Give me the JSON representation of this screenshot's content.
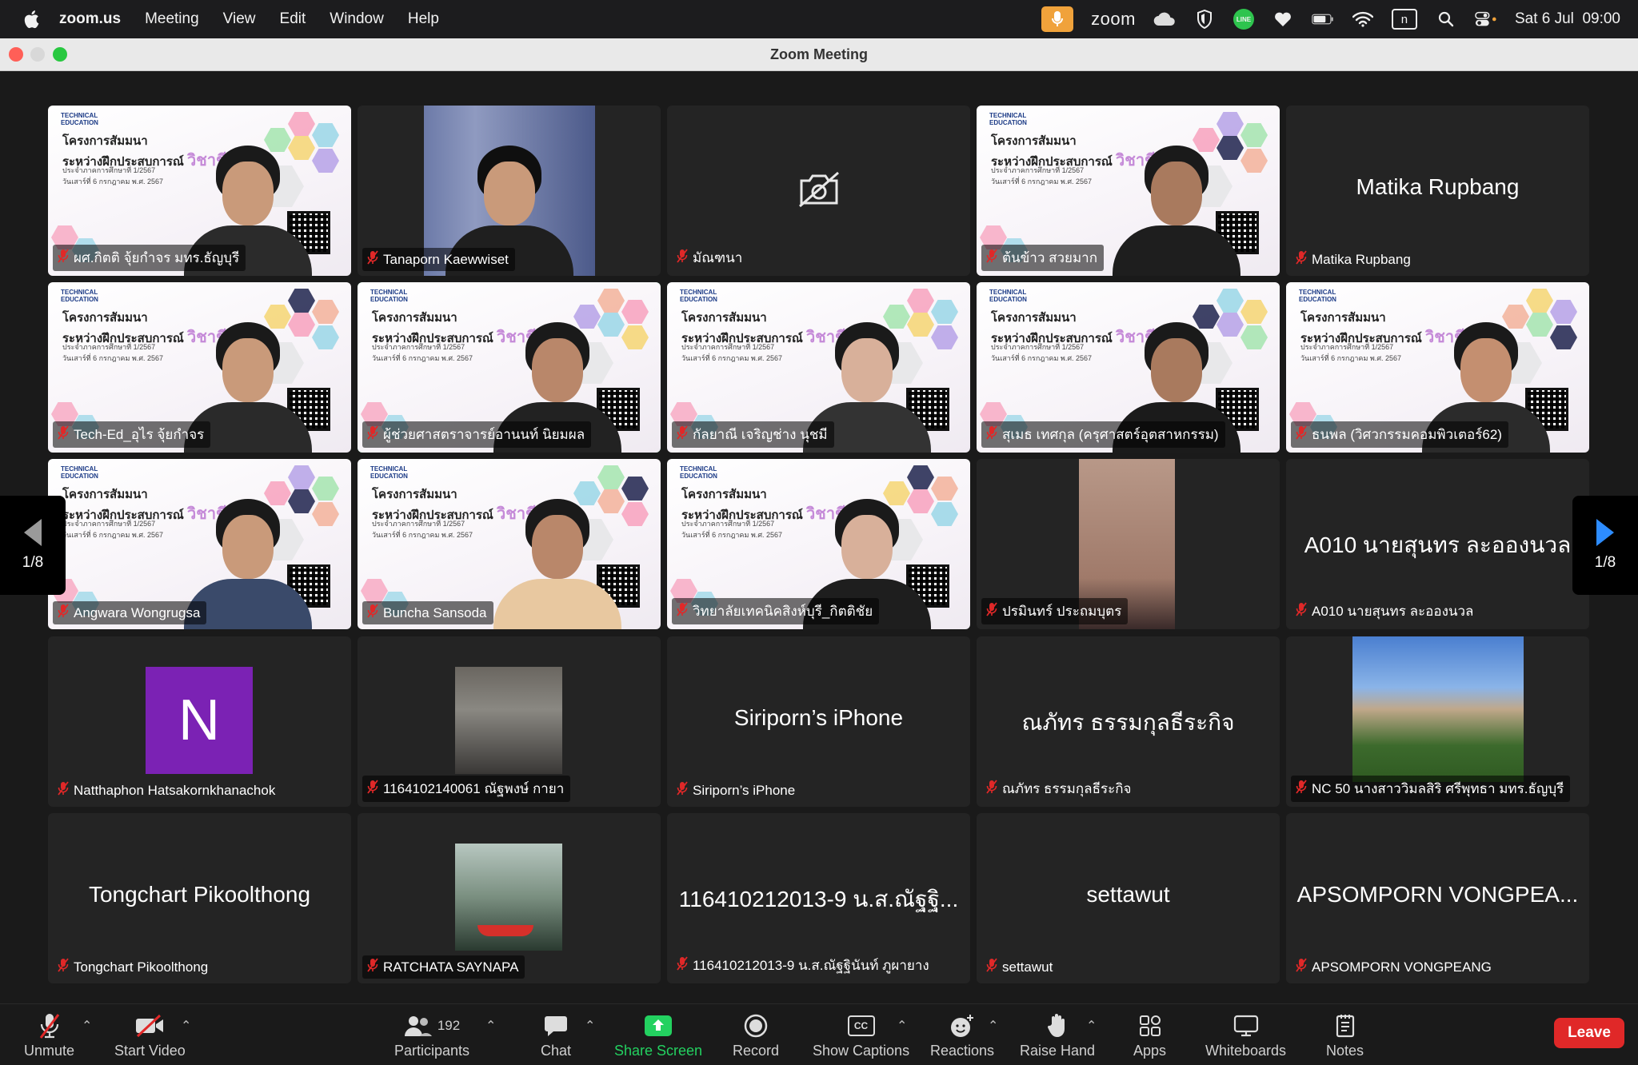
{
  "menubar": {
    "app_name": "zoom.us",
    "menus": [
      "Meeting",
      "View",
      "Edit",
      "Window",
      "Help"
    ],
    "zoom_label": "zoom",
    "line_label": "LINE",
    "n_label": "n",
    "datetime": "Sat 6 Jul  09:00"
  },
  "window": {
    "title": "Zoom Meeting"
  },
  "slide": {
    "logo": "TECHNICAL EDUCATION",
    "line1": "โครงการสัมมนา",
    "line2_prefix": "ระหว่างฝึกประสบการณ์",
    "line2_accent": "วิชาชีพครู",
    "line3": "ประจำภาคการศึกษาที่ 1/2567",
    "line4": "วันเสาร์ที่ 6 กรกฎาคม พ.ศ. 2567"
  },
  "participants": [
    {
      "label": "ผศ.กิตติ จุ้ยกำจร มทร.ธัญบุรี",
      "kind": "slide"
    },
    {
      "label": "Tanaporn Kaewwiset",
      "kind": "video"
    },
    {
      "label": "มัณฑนา",
      "kind": "camoff"
    },
    {
      "label": "ต้นข้าว สวยมาก",
      "kind": "slide"
    },
    {
      "label": "Matika Rupbang",
      "display_name": "Matika Rupbang",
      "kind": "name"
    },
    {
      "label": "Tech-Ed_อุไร จุ้ยกำจร",
      "kind": "slide"
    },
    {
      "label": "ผู้ช่วยศาสตราจารย์อานนท์ นิยมผล",
      "kind": "slide",
      "active": true
    },
    {
      "label": "กัลยาณี เจริญช่าง นุชมี",
      "kind": "slide"
    },
    {
      "label": "สุเมธ เทศกุล (ครุศาสตร์อุตสาหกรรม)",
      "kind": "slide"
    },
    {
      "label": "ธนพล (วิศวกรรมคอมพิวเตอร์62)",
      "kind": "slide"
    },
    {
      "label": "Angwara Wongrugsa",
      "kind": "slide"
    },
    {
      "label": "Buncha Sansoda",
      "kind": "slide"
    },
    {
      "label": "วิทยาลัยเทคนิคสิงห์บุรี_กิตติชัย",
      "kind": "slide"
    },
    {
      "label": "ปรมินทร์ ประถมบุตร",
      "kind": "video"
    },
    {
      "label": "A010 นายสุนทร ละอองนวล",
      "display_name": "A010 นายสุนทร ละอองนวล",
      "kind": "name"
    },
    {
      "label": "Natthaphon Hatsakornkhanachok",
      "avatar_letter": "N",
      "kind": "avatar"
    },
    {
      "label": "1164102140061 ณัฐพงษ์ กายา",
      "kind": "photo"
    },
    {
      "label": "Siriporn’s iPhone",
      "display_name": "Siriporn’s iPhone",
      "kind": "name"
    },
    {
      "label": "ณภัทร ธรรมกุลธีระกิจ",
      "display_name": "ณภัทร ธรรมกุลธีระกิจ",
      "kind": "name"
    },
    {
      "label": "NC 50 นางสาววิมลสิริ ศรีพุทธา มทร.ธัญบุรี",
      "kind": "photo"
    },
    {
      "label": "Tongchart Pikoolthong",
      "display_name": "Tongchart Pikoolthong",
      "kind": "name"
    },
    {
      "label": "RATCHATA SAYNAPA",
      "kind": "photo"
    },
    {
      "label": "116410212013-9 น.ส.ณัฐฐินันท์ ภูผายาง",
      "display_name": "116410212013-9 น.ส.ณัฐฐิ...",
      "kind": "name"
    },
    {
      "label": "settawut",
      "display_name": "settawut",
      "kind": "name"
    },
    {
      "label": "APSOMPORN VONGPEANG",
      "display_name": "APSOMPORN VONGPEA...",
      "kind": "name"
    }
  ],
  "pager": {
    "left": "1/8",
    "right": "1/8"
  },
  "toolbar": {
    "unmute": "Unmute",
    "start_video": "Start Video",
    "participants": "Participants",
    "participant_count": "192",
    "chat": "Chat",
    "share_screen": "Share Screen",
    "record": "Record",
    "show_captions": "Show Captions",
    "cc": "CC",
    "reactions": "Reactions",
    "raise_hand": "Raise Hand",
    "apps": "Apps",
    "whiteboards": "Whiteboards",
    "notes": "Notes",
    "leave": "Leave"
  },
  "colors": {
    "active_speaker": "#23d160",
    "leave": "#e02828",
    "mic_muted": "#e02828",
    "avatar_bg": "#7b22b4"
  }
}
